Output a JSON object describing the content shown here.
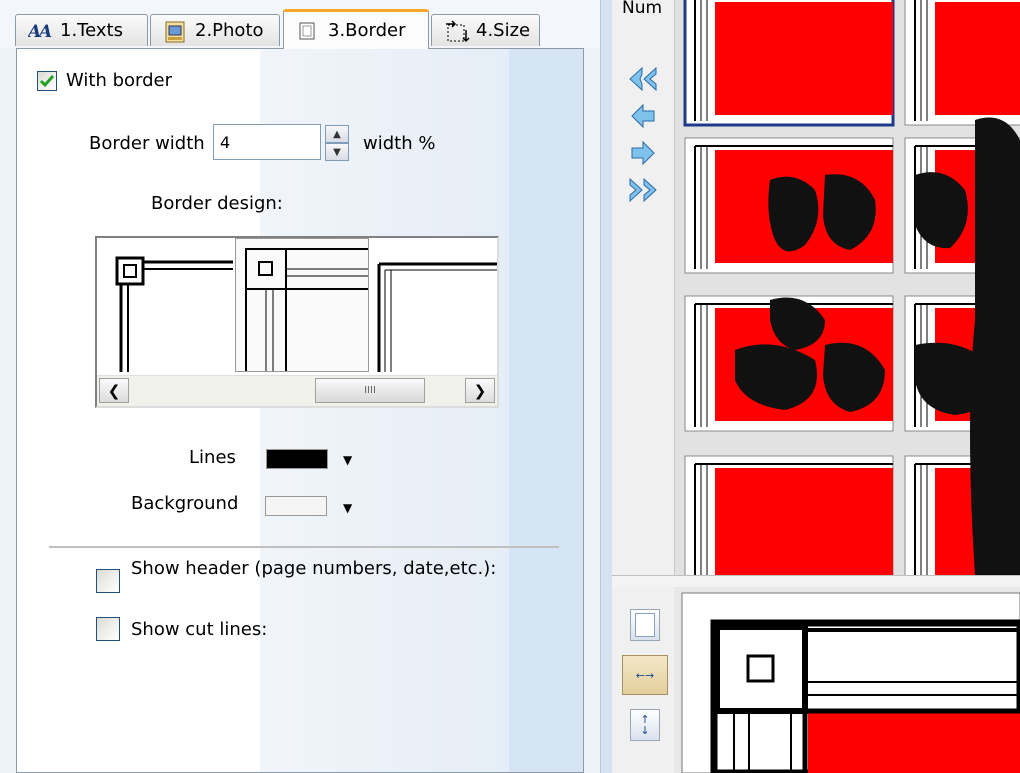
{
  "tabs": [
    {
      "label": "1.Texts",
      "icon": "text-size-icon"
    },
    {
      "label": "2.Photo",
      "icon": "photo-icon"
    },
    {
      "label": "3.Border",
      "icon": "border-icon",
      "active": true
    },
    {
      "label": "4.Size",
      "icon": "resize-icon"
    }
  ],
  "border_settings": {
    "with_border_label": "With border",
    "with_border_checked": true,
    "border_width_label": "Border width",
    "border_width_value": "4",
    "border_width_unit": "width %",
    "border_design_label": "Border design:",
    "lines_label": "Lines",
    "lines_color": "#000000",
    "background_label": "Background",
    "background_color": "#f5f5f5",
    "show_header_label": "Show header (page numbers, date,etc.):",
    "show_header_checked": false,
    "show_cut_lines_label": "Show cut lines:",
    "show_cut_lines_checked": false
  },
  "scrollbar": {
    "thumb_glyph": "IIII"
  },
  "pages_panel": {
    "column_header": "Num"
  },
  "colors": {
    "tab_active_accent": "#f5a623",
    "poster_red": "#ff0000",
    "checkbox_border": "#1c5180",
    "panel_bg_right": "#d6e5f4"
  }
}
